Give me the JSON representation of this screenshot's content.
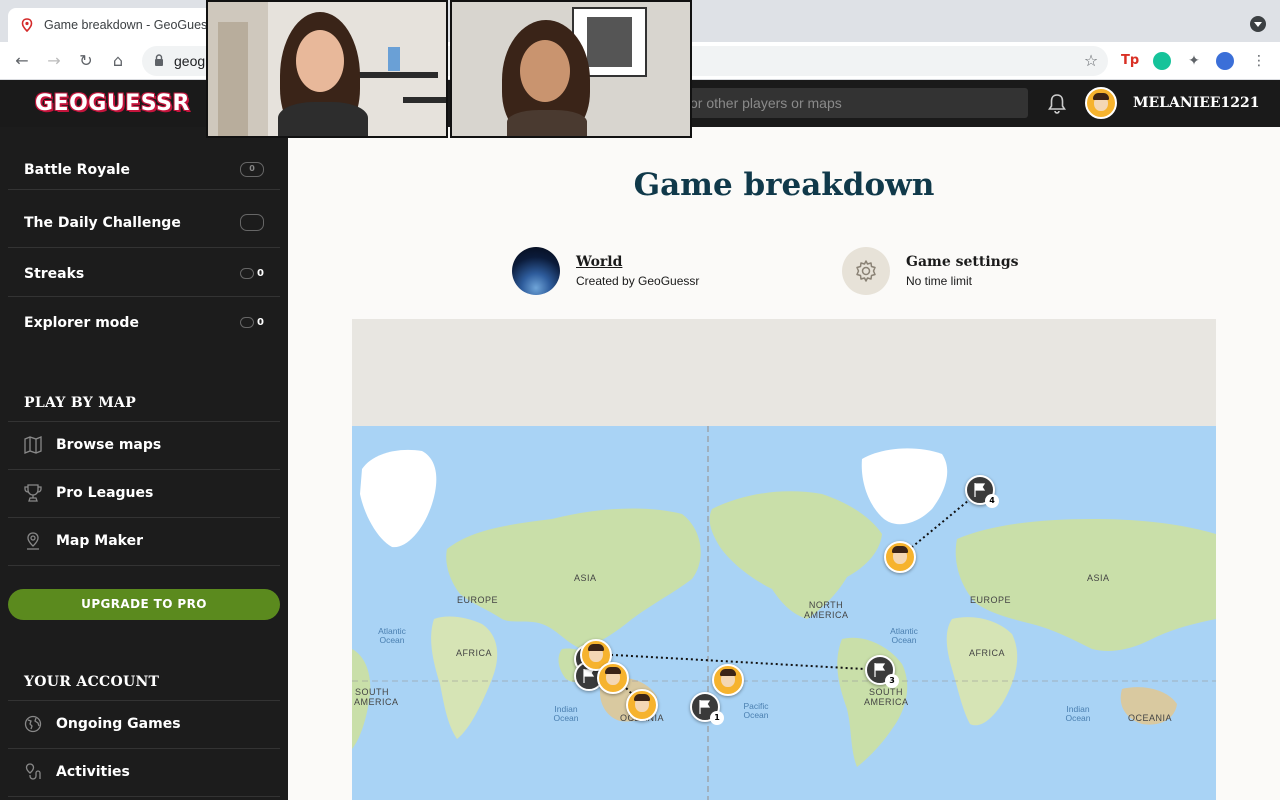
{
  "browser": {
    "tab_title": "Game breakdown - GeoGues",
    "url": "geog"
  },
  "header": {
    "logo": "GEOGUESSR",
    "search_placeholder": "or other players or maps",
    "username": "MELANIEE1221"
  },
  "sidebar": {
    "modes": [
      {
        "label": "Battle Royale",
        "count": "0"
      },
      {
        "label": "The Daily Challenge",
        "count": ""
      },
      {
        "label": "Streaks",
        "count": "0"
      },
      {
        "label": "Explorer mode",
        "count": "0"
      }
    ],
    "play_by_map_title": "PLAY BY MAP",
    "play_by_map": [
      {
        "label": "Browse maps",
        "icon": "map-icon"
      },
      {
        "label": "Pro Leagues",
        "icon": "trophy-icon"
      },
      {
        "label": "Map Maker",
        "icon": "pin-icon"
      }
    ],
    "upgrade_label": "UPGRADE TO PRO",
    "account_title": "YOUR ACCOUNT",
    "account": [
      {
        "label": "Ongoing Games",
        "icon": "globe-icon"
      },
      {
        "label": "Activities",
        "icon": "activity-icon"
      }
    ]
  },
  "main": {
    "title": "Game breakdown",
    "map_name": "World",
    "map_creator": "Created by GeoGuessr",
    "settings_title": "Game settings",
    "settings_value": "No time limit"
  },
  "map": {
    "labels": [
      "ASIA",
      "EUROPE",
      "AFRICA",
      "SOUTH AMERICA",
      "OCEANIA",
      "NORTH AMERICA",
      "SOUTH AMERICA",
      "AFRICA",
      "EUROPE",
      "ASIA",
      "OCEANIA"
    ],
    "oceans": [
      "Atlantic Ocean",
      "Indian Ocean",
      "Pacific Ocean",
      "Atlantic Ocean",
      "Indian Ocean"
    ],
    "rounds": [
      "1",
      "3",
      "4"
    ]
  },
  "colors": {
    "sidebar_bg": "#1c1c1c",
    "accent_green": "#5b8a1e",
    "title_color": "#10394a",
    "guess_pin": "#f6b32e"
  }
}
